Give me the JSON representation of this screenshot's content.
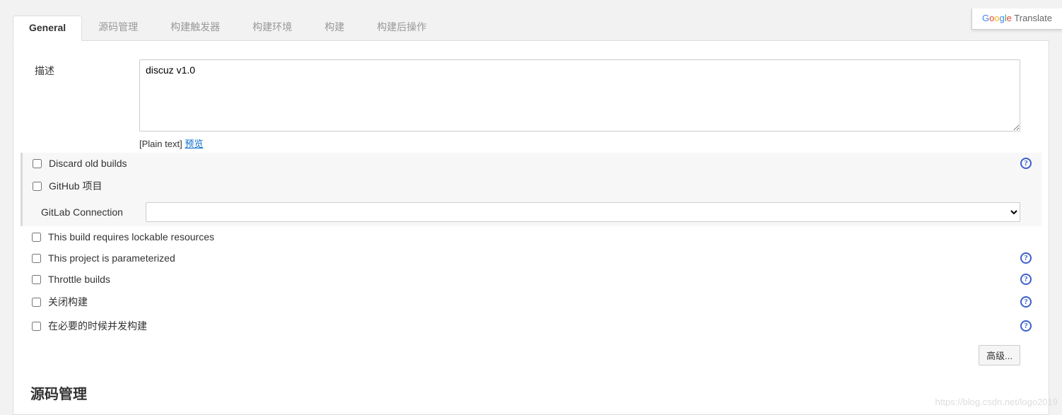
{
  "translate_badge": {
    "brand": "Google",
    "product": "Translate"
  },
  "tabs": [
    {
      "label": "General",
      "active": true
    },
    {
      "label": "源码管理",
      "active": false
    },
    {
      "label": "构建触发器",
      "active": false
    },
    {
      "label": "构建环境",
      "active": false
    },
    {
      "label": "构建",
      "active": false
    },
    {
      "label": "构建后操作",
      "active": false
    }
  ],
  "description": {
    "label": "描述",
    "value": "discuz v1.0",
    "hint_prefix": "[Plain text] ",
    "preview_link": "预览"
  },
  "options": {
    "discard_old_builds": {
      "label": "Discard old builds",
      "checked": false,
      "help": true
    },
    "github_project": {
      "label": "GitHub 项目",
      "checked": false,
      "help": false
    },
    "gitlab_connection": {
      "label": "GitLab Connection",
      "value": ""
    },
    "lockable_resources": {
      "label": "This build requires lockable resources",
      "checked": false,
      "help": false
    },
    "parameterized": {
      "label": "This project is parameterized",
      "checked": false,
      "help": true
    },
    "throttle": {
      "label": "Throttle builds",
      "checked": false,
      "help": true
    },
    "disable": {
      "label": "关闭构建",
      "checked": false,
      "help": true
    },
    "concurrent": {
      "label": "在必要的时候并发构建",
      "checked": false,
      "help": true
    }
  },
  "advanced_button": "高级...",
  "section_title": "源码管理",
  "watermark": "https://blog.csdn.net/logo2019"
}
